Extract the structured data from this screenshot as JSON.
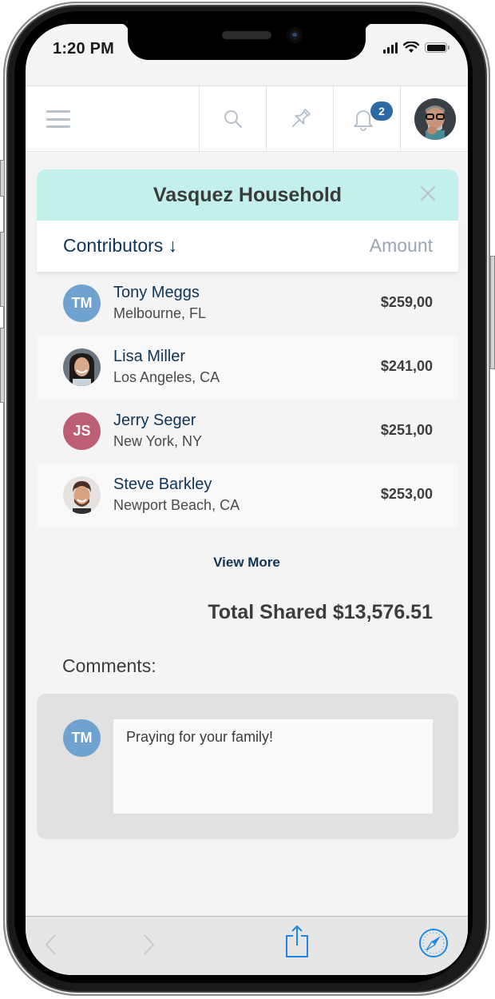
{
  "status_bar": {
    "time": "1:20 PM",
    "icons": [
      "signal-icon",
      "wifi-icon",
      "battery-icon"
    ]
  },
  "app_bar": {
    "menu_icon": "hamburger-menu-icon",
    "search_icon": "search-icon",
    "pin_icon": "pin-icon",
    "notifications_icon": "bell-icon",
    "notification_count": "2",
    "profile_avatar": "user-profile-photo"
  },
  "card": {
    "title": "Vasquez Household",
    "close_icon": "close-icon",
    "columns": {
      "contributors": "Contributors",
      "sort_icon": "arrow-down-icon",
      "sort_glyph": "↓",
      "amount": "Amount"
    },
    "contributors": [
      {
        "name": "Tony Meggs",
        "location": "Melbourne, FL",
        "amount": "$259,00",
        "initials": "TM",
        "avatar_type": "initials",
        "avatar_color": "#6fa2cf"
      },
      {
        "name": "Lisa Miller",
        "location": "Los Angeles, CA",
        "amount": "$241,00",
        "initials": "",
        "avatar_type": "photo",
        "avatar_color": ""
      },
      {
        "name": "Jerry Seger",
        "location": "New York, NY",
        "amount": "$251,00",
        "initials": "JS",
        "avatar_type": "initials",
        "avatar_color": "#bc5f74"
      },
      {
        "name": "Steve Barkley",
        "location": "Newport Beach, CA",
        "amount": "$253,00",
        "initials": "",
        "avatar_type": "photo",
        "avatar_color": ""
      }
    ],
    "view_more": "View More",
    "total": "Total Shared $13,576.51"
  },
  "comments": {
    "label": "Comments:",
    "items": [
      {
        "initials": "TM",
        "text": "Praying for your family!"
      }
    ]
  },
  "browser_toolbar": {
    "back_icon": "chevron-left-icon",
    "forward_icon": "chevron-right-icon",
    "share_icon": "share-icon",
    "safari_icon": "compass-icon"
  },
  "colors": {
    "card_header_bg": "#c3f0eb",
    "primary_text": "#0f3556",
    "badge": "#2d6aa3",
    "ios_blue": "#1e88e5"
  }
}
